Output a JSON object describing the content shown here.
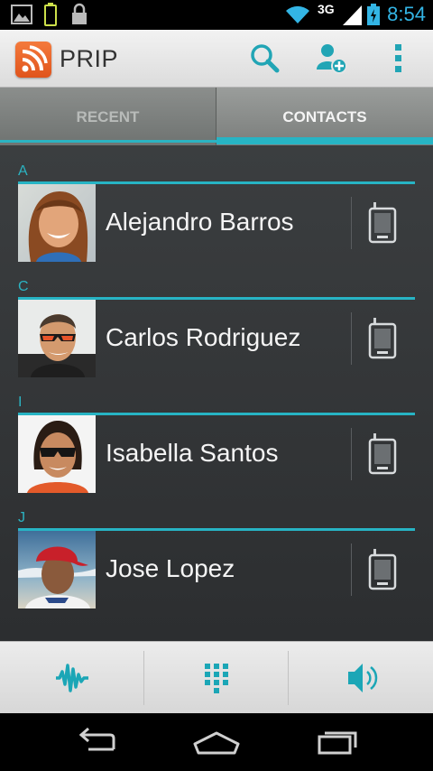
{
  "status_bar": {
    "time": "8:54",
    "network": "3G",
    "icons": [
      "image-notification-icon",
      "battery-notification-icon",
      "lock-icon",
      "wifi-icon",
      "signal-icon",
      "battery-icon"
    ]
  },
  "action_bar": {
    "app_title": "PRIP",
    "app_icon": "prip-logo-icon",
    "actions": [
      "search-icon",
      "add-contact-icon",
      "overflow-menu-icon"
    ]
  },
  "tabs": [
    {
      "label": "RECENT",
      "selected": false
    },
    {
      "label": "CONTACTS",
      "selected": true
    }
  ],
  "contacts": [
    {
      "section": "A",
      "name": "Alejandro Barros",
      "action_icon": "walkie-talkie-icon"
    },
    {
      "section": "C",
      "name": "Carlos Rodriguez",
      "action_icon": "walkie-talkie-icon"
    },
    {
      "section": "I",
      "name": "Isabella Santos",
      "action_icon": "walkie-talkie-icon"
    },
    {
      "section": "J",
      "name": "Jose Lopez",
      "action_icon": "walkie-talkie-icon"
    }
  ],
  "bottom_bar": {
    "buttons": [
      "voice-waveform-icon",
      "dialpad-icon",
      "speaker-icon"
    ]
  },
  "nav_bar": {
    "buttons": [
      "back-icon",
      "home-icon",
      "recent-apps-icon"
    ]
  },
  "colors": {
    "accent": "#27b4c4",
    "status_time": "#33b5e5",
    "logo": "#e8602a",
    "list_background": "#333638"
  }
}
